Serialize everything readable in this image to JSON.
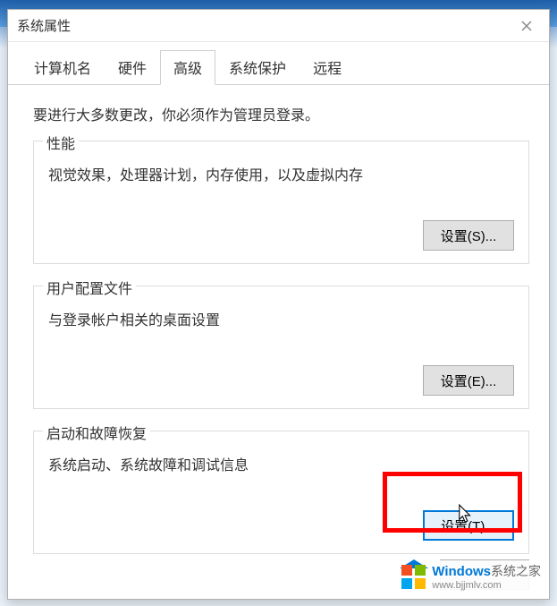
{
  "window": {
    "title": "系统属性"
  },
  "tabs": {
    "t0": "计算机名",
    "t1": "硬件",
    "t2": "高级",
    "t3": "系统保护",
    "t4": "远程"
  },
  "advanced": {
    "admin_note": "要进行大多数更改，你必须作为管理员登录。",
    "performance": {
      "legend": "性能",
      "desc": "视觉效果，处理器计划，内存使用，以及虚拟内存",
      "button": "设置(S)..."
    },
    "user_profiles": {
      "legend": "用户配置文件",
      "desc": "与登录帐户相关的桌面设置",
      "button": "设置(E)..."
    },
    "startup": {
      "legend": "启动和故障恢复",
      "desc": "系统启动、系统故障和调试信息",
      "button": "设置(T)..."
    }
  },
  "watermark": {
    "brand": "Windows",
    "suffix": "系统之家",
    "url": "www.bjjmlv.com"
  }
}
